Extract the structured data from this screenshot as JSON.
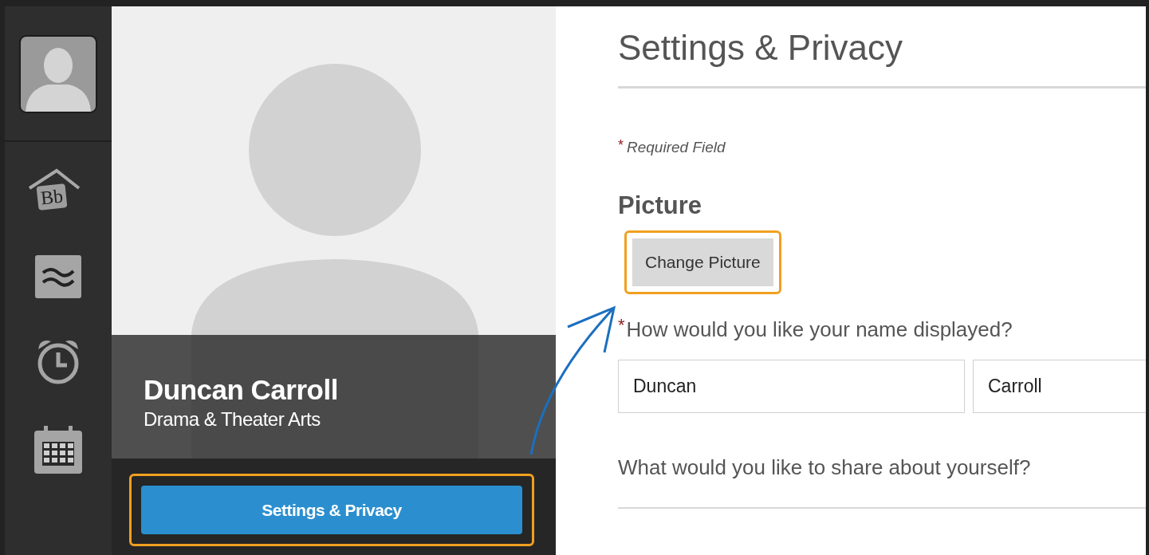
{
  "sidebar": {
    "items": [
      {
        "kind": "avatar"
      },
      {
        "kind": "logo",
        "text": "Bb"
      },
      {
        "kind": "waves"
      },
      {
        "kind": "alarm"
      },
      {
        "kind": "calendar"
      }
    ]
  },
  "profile": {
    "name": "Duncan Carroll",
    "department": "Drama & Theater Arts",
    "button": {
      "label": "Settings & Privacy",
      "highlighted": true
    }
  },
  "settings": {
    "title": "Settings & Privacy",
    "required_note": {
      "mark": "*",
      "text": "Required Field"
    },
    "section": "Picture",
    "change_button": {
      "label": "Change Picture",
      "highlighted": true
    },
    "questions": [
      {
        "mark": "*",
        "text": "How would you like your name displayed?",
        "fields": [
          {
            "value": "Duncan"
          },
          {
            "value": "Carroll"
          }
        ]
      },
      {
        "text": "What would you like to share about yourself?"
      }
    ]
  }
}
